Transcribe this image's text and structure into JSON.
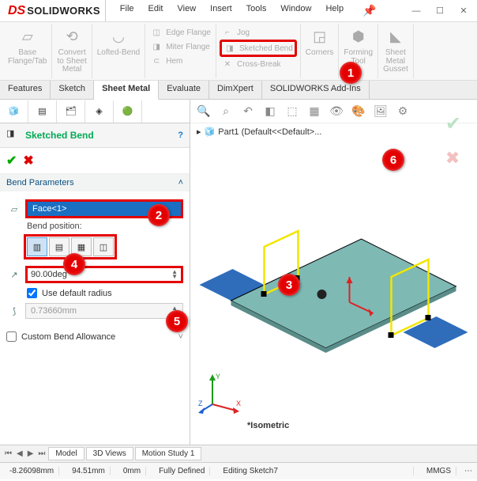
{
  "app": {
    "brand_ds": "DS",
    "brand_sw": "SOLIDWORKS"
  },
  "menu": {
    "file": "File",
    "edit": "Edit",
    "view": "View",
    "insert": "Insert",
    "tools": "Tools",
    "window": "Window",
    "help": "Help"
  },
  "ribbon": {
    "base_flange": "Base\nFlange/Tab",
    "convert": "Convert\nto Sheet\nMetal",
    "lofted": "Lofted-Bend",
    "edge_flange": "Edge Flange",
    "miter_flange": "Miter Flange",
    "hem": "Hem",
    "jog": "Jog",
    "sketched_bend": "Sketched Bend",
    "cross_break": "Cross-Break",
    "corners": "Corners",
    "forming": "Forming\nTool",
    "gusset": "Sheet\nMetal\nGusset"
  },
  "tabs": {
    "features": "Features",
    "sketch": "Sketch",
    "sheet_metal": "Sheet Metal",
    "evaluate": "Evaluate",
    "dimxpert": "DimXpert",
    "addins": "SOLIDWORKS Add-Ins"
  },
  "panel": {
    "title": "Sketched Bend",
    "section_params": "Bend Parameters",
    "face_sel": "Face<1>",
    "bend_pos_label": "Bend position:",
    "angle": "90.00deg",
    "use_default_radius": "Use default radius",
    "radius": "0.73660mm",
    "custom_allowance": "Custom Bend Allowance"
  },
  "crumb": {
    "part": "Part1  (Default<<Default>..."
  },
  "iso": "*Isometric",
  "bottom": {
    "model": "Model",
    "views3d": "3D Views",
    "motion": "Motion Study 1"
  },
  "status": {
    "x": "-8.26098mm",
    "y": "94.51mm",
    "z": "0mm",
    "defined": "Fully Defined",
    "editing": "Editing Sketch7",
    "units": "MMGS"
  },
  "callouts": {
    "c1": "1",
    "c2": "2",
    "c3": "3",
    "c4": "4",
    "c5": "5",
    "c6": "6"
  }
}
